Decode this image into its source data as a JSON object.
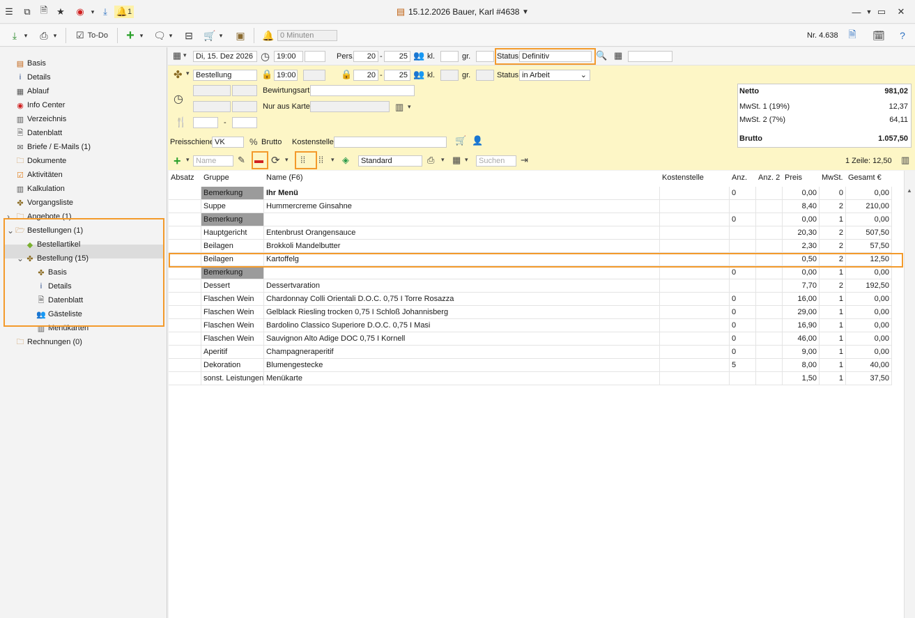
{
  "window": {
    "title": "15.12.2026 Bauer, Karl #4638",
    "notification_count": "1"
  },
  "toolbar": {
    "todo_label": "To-Do",
    "minutes_value": "0 Minuten",
    "record_number": "Nr. 4.638"
  },
  "sidebar": {
    "items": [
      {
        "label": "Basis",
        "icon": "basis-icon"
      },
      {
        "label": "Details",
        "icon": "info-icon"
      },
      {
        "label": "Ablauf",
        "icon": "calendar-icon"
      },
      {
        "label": "Info Center",
        "icon": "compass-icon"
      },
      {
        "label": "Verzeichnis",
        "icon": "directory-icon"
      },
      {
        "label": "Datenblatt",
        "icon": "document-icon"
      },
      {
        "label": "Briefe / E-Mails (1)",
        "icon": "letter-icon"
      },
      {
        "label": "Dokumente",
        "icon": "folder-icon"
      },
      {
        "label": "Aktivitäten",
        "icon": "checkbox-icon"
      },
      {
        "label": "Kalkulation",
        "icon": "calculator-icon"
      },
      {
        "label": "Vorgangsliste",
        "icon": "puzzle-icon"
      },
      {
        "label": "Angebote (1)",
        "icon": "folder-icon"
      },
      {
        "label": "Bestellungen (1)",
        "icon": "folder-open-icon"
      },
      {
        "label": "Bestellartikel",
        "icon": "tag-icon"
      },
      {
        "label": "Bestellung (15)",
        "icon": "puzzle-icon"
      },
      {
        "label": "Basis",
        "icon": "puzzle-icon"
      },
      {
        "label": "Details",
        "icon": "info-icon"
      },
      {
        "label": "Datenblatt",
        "icon": "document-icon"
      },
      {
        "label": "Gästeliste",
        "icon": "guests-icon"
      },
      {
        "label": "Menükarten",
        "icon": "menu-card-icon"
      },
      {
        "label": "Rechnungen (0)",
        "icon": "folder-icon"
      }
    ]
  },
  "form": {
    "date": "Di, 15. Dez 2026",
    "time_start": "19:00",
    "time_end": "",
    "pers_label": "Pers.",
    "pers_min": "20",
    "pers_max": "25",
    "kl_label": "kl.",
    "gr_label": "gr.",
    "status_label": "Status",
    "status_value": "Definitiv",
    "order_name": "Bestellung",
    "order_time": "19:00",
    "order_pers_min": "20",
    "order_pers_max": "25",
    "order_status_value": "in Arbeit",
    "bewirtungsart_label": "Bewirtungsart",
    "nur_aus_karte_label": "Nur aus Karte",
    "dash": "-",
    "preisschiene_label": "Preisschiene",
    "preisschiene_value": "VK",
    "brutto_label": "Brutto",
    "kostenstelle_label": "Kostenstelle"
  },
  "totals": {
    "netto_label": "Netto",
    "netto_value": "981,02",
    "mwst1_label": "MwSt. 1 (19%)",
    "mwst1_value": "12,37",
    "mwst2_label": "MwSt. 2 (7%)",
    "mwst2_value": "64,11",
    "brutto_label": "Brutto",
    "brutto_value": "1.057,50"
  },
  "grid_toolbar": {
    "name_placeholder": "Name",
    "view_value": "Standard",
    "search_placeholder": "Suchen",
    "row_info": "1 Zeile: 12,50"
  },
  "grid": {
    "headers": [
      "Absatz",
      "Gruppe",
      "Name (F6)",
      "Kostenstelle",
      "Anz.",
      "Anz. 2",
      "Preis",
      "MwSt.",
      "Gesamt €"
    ],
    "rows": [
      {
        "gruppe": "Bemerkung",
        "name": "Ihr Menü",
        "anz": "0",
        "preis": "0,00",
        "mwst": "0",
        "gesamt": "0,00",
        "bemerkung": true,
        "bold": true
      },
      {
        "gruppe": "Suppe",
        "name": "Hummercreme Ginsahne",
        "anz": "",
        "preis": "8,40",
        "mwst": "2",
        "gesamt": "210,00"
      },
      {
        "gruppe": "Bemerkung",
        "name": "",
        "anz": "0",
        "preis": "0,00",
        "mwst": "1",
        "gesamt": "0,00",
        "bemerkung": true
      },
      {
        "gruppe": "Hauptgericht",
        "name": "Entenbrust Orangensauce",
        "anz": "",
        "preis": "20,30",
        "mwst": "2",
        "gesamt": "507,50"
      },
      {
        "gruppe": "Beilagen",
        "name": "Brokkoli Mandelbutter",
        "anz": "",
        "preis": "2,30",
        "mwst": "2",
        "gesamt": "57,50"
      },
      {
        "gruppe": "Beilagen",
        "name": "Kartoffelg",
        "anz": "",
        "preis": "0,50",
        "mwst": "2",
        "gesamt": "12,50",
        "selected": true
      },
      {
        "gruppe": "Bemerkung",
        "name": "",
        "anz": "0",
        "preis": "0,00",
        "mwst": "1",
        "gesamt": "0,00",
        "bemerkung": true
      },
      {
        "gruppe": "Dessert",
        "name": "Dessertvaration",
        "anz": "",
        "preis": "7,70",
        "mwst": "2",
        "gesamt": "192,50"
      },
      {
        "gruppe": "Flaschen Wein",
        "name": "Chardonnay Colli Orientali D.O.C. 0,75 I Torre Rosazza",
        "anz": "0",
        "preis": "16,00",
        "mwst": "1",
        "gesamt": "0,00"
      },
      {
        "gruppe": "Flaschen Wein",
        "name": "Gelblack Riesling trocken 0,75 I Schloß Johannisberg",
        "anz": "0",
        "preis": "29,00",
        "mwst": "1",
        "gesamt": "0,00"
      },
      {
        "gruppe": "Flaschen Wein",
        "name": "Bardolino Classico Superiore D.O.C. 0,75 I Masi",
        "anz": "0",
        "preis": "16,90",
        "mwst": "1",
        "gesamt": "0,00"
      },
      {
        "gruppe": "Flaschen Wein",
        "name": "Sauvignon Alto Adige DOC 0,75 I Kornell",
        "anz": "0",
        "preis": "46,00",
        "mwst": "1",
        "gesamt": "0,00"
      },
      {
        "gruppe": "Aperitif",
        "name": "Champagneraperitif",
        "anz": "0",
        "preis": "9,00",
        "mwst": "1",
        "gesamt": "0,00"
      },
      {
        "gruppe": "Dekoration",
        "name": "Blumengestecke",
        "anz": "5",
        "preis": "8,00",
        "mwst": "1",
        "gesamt": "40,00"
      },
      {
        "gruppe": "sonst. Leistungen",
        "name": "Menükarte",
        "anz": "",
        "preis": "1,50",
        "mwst": "1",
        "gesamt": "37,50"
      }
    ]
  }
}
